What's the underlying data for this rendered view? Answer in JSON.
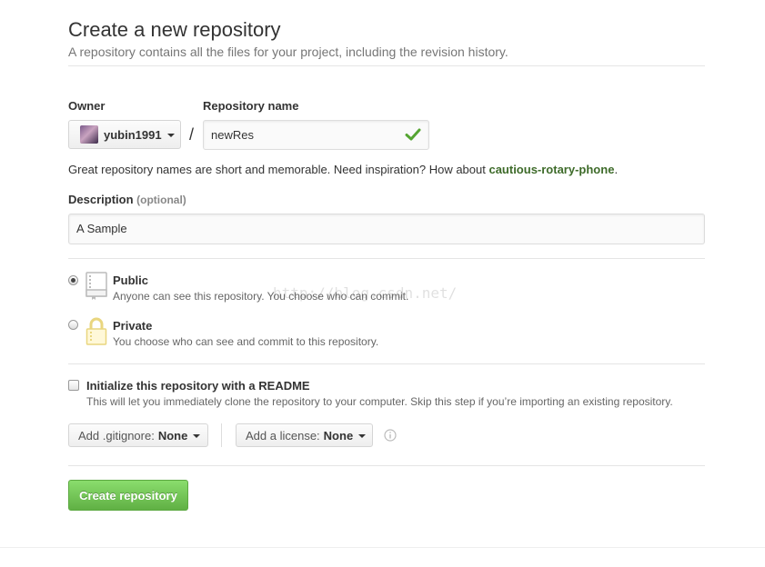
{
  "header": {
    "title": "Create a new repository",
    "subtitle": "A repository contains all the files for your project, including the revision history."
  },
  "owner": {
    "label": "Owner",
    "name": "yubin1991"
  },
  "repo": {
    "label": "Repository name",
    "value": "newRes"
  },
  "separator": "/",
  "hint": {
    "prefix": "Great repository names are short and memorable. Need inspiration? How about ",
    "suggestion": "cautious-rotary-phone",
    "suffix": "."
  },
  "description": {
    "label": "Description",
    "optional": "(optional)",
    "value": "A Sample"
  },
  "visibility": {
    "public": {
      "title": "Public",
      "desc": "Anyone can see this repository. You choose who can commit.",
      "checked": true
    },
    "private": {
      "title": "Private",
      "desc": "You choose who can see and commit to this repository.",
      "checked": false
    }
  },
  "readme": {
    "title": "Initialize this repository with a README",
    "desc": "This will let you immediately clone the repository to your computer. Skip this step if you’re importing an existing repository."
  },
  "gitignore": {
    "label": "Add .gitignore:",
    "value": "None"
  },
  "license": {
    "label": "Add a license:",
    "value": "None"
  },
  "submit": {
    "label": "Create repository"
  },
  "watermark": "http://blog.csdn.net/",
  "colors": {
    "accent_green": "#60b044",
    "suggest_green": "#3e6b2a",
    "check_green": "#55a532"
  },
  "icons": [
    "caret-down-icon",
    "check-icon",
    "repo-book-icon",
    "lock-icon",
    "info-icon"
  ]
}
